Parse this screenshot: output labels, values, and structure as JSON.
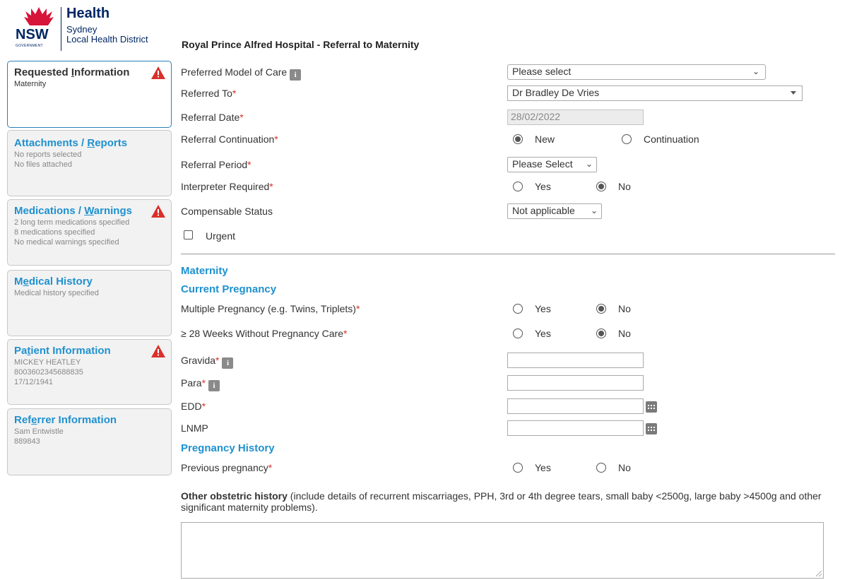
{
  "header": {
    "logo_nsw": "NSW",
    "logo_government": "GOVERNMENT",
    "logo_health": "Health",
    "logo_sydney": "Sydney",
    "logo_lhd": "Local Health District",
    "title": "Royal Prince Alfred Hospital - Referral to Maternity"
  },
  "sidebar": {
    "requested": {
      "title_pre": "Requested ",
      "title_ul": "I",
      "title_post": "nformation",
      "line1": "Maternity"
    },
    "attachments": {
      "title_pre": "Attachments / ",
      "title_ul": "R",
      "title_post": "eports",
      "line1": "No reports selected",
      "line2": "No files attached"
    },
    "medications": {
      "title_pre": "Medications / ",
      "title_ul": "W",
      "title_post": "arnings",
      "line1": "2 long term medications specified",
      "line2": "8 medications specified",
      "line3": "No medical warnings specified"
    },
    "history": {
      "title_pre": "M",
      "title_ul": "e",
      "title_post": "dical History",
      "line1": "Medical history specified"
    },
    "patient": {
      "title_pre": "Pa",
      "title_ul": "t",
      "title_post": "ient Information",
      "line1": "MICKEY HEATLEY",
      "line2": "8003602345688835",
      "line3": "17/12/1941"
    },
    "referrer": {
      "title_pre": "Ref",
      "title_ul": "e",
      "title_post": "rrer Information",
      "line1": "Sam Entwistle",
      "line2": "889843"
    }
  },
  "form": {
    "model_of_care": {
      "label": "Preferred Model of Care",
      "value": "Please select"
    },
    "referred_to": {
      "label": "Referred To",
      "value": "Dr Bradley De Vries"
    },
    "referral_date": {
      "label": "Referral Date",
      "value": "28/02/2022"
    },
    "continuation": {
      "label": "Referral Continuation",
      "opt1": "New",
      "opt2": "Continuation"
    },
    "period": {
      "label": "Referral Period",
      "value": "Please Select"
    },
    "interpreter": {
      "label": "Interpreter Required",
      "opt1": "Yes",
      "opt2": "No"
    },
    "compensable": {
      "label": "Compensable Status",
      "value": "Not applicable"
    },
    "urgent": {
      "label": "Urgent"
    },
    "section_maternity": "Maternity",
    "section_current": "Current Pregnancy",
    "multiple": {
      "label": "Multiple Pregnancy (e.g. Twins, Triplets)",
      "opt1": "Yes",
      "opt2": "No"
    },
    "weeks28": {
      "label": "≥ 28 Weeks Without Pregnancy Care",
      "opt1": "Yes",
      "opt2": "No"
    },
    "gravida": {
      "label": "Gravida"
    },
    "para": {
      "label": "Para"
    },
    "edd": {
      "label": "EDD"
    },
    "lnmp": {
      "label": "LNMP"
    },
    "section_history": "Pregnancy History",
    "previous": {
      "label": "Previous pregnancy",
      "opt1": "Yes",
      "opt2": "No"
    },
    "other_bold": "Other obstetric history",
    "other_rest": " (include details of recurrent miscarriages, PPH, 3rd or 4th degree tears, small baby <2500g, large baby >4500g and other significant maternity problems).",
    "required_mark": "*",
    "info_glyph": "i"
  },
  "colors": {
    "brand": "#002664",
    "accent": "#1f91cf",
    "warning": "#d9302b"
  }
}
